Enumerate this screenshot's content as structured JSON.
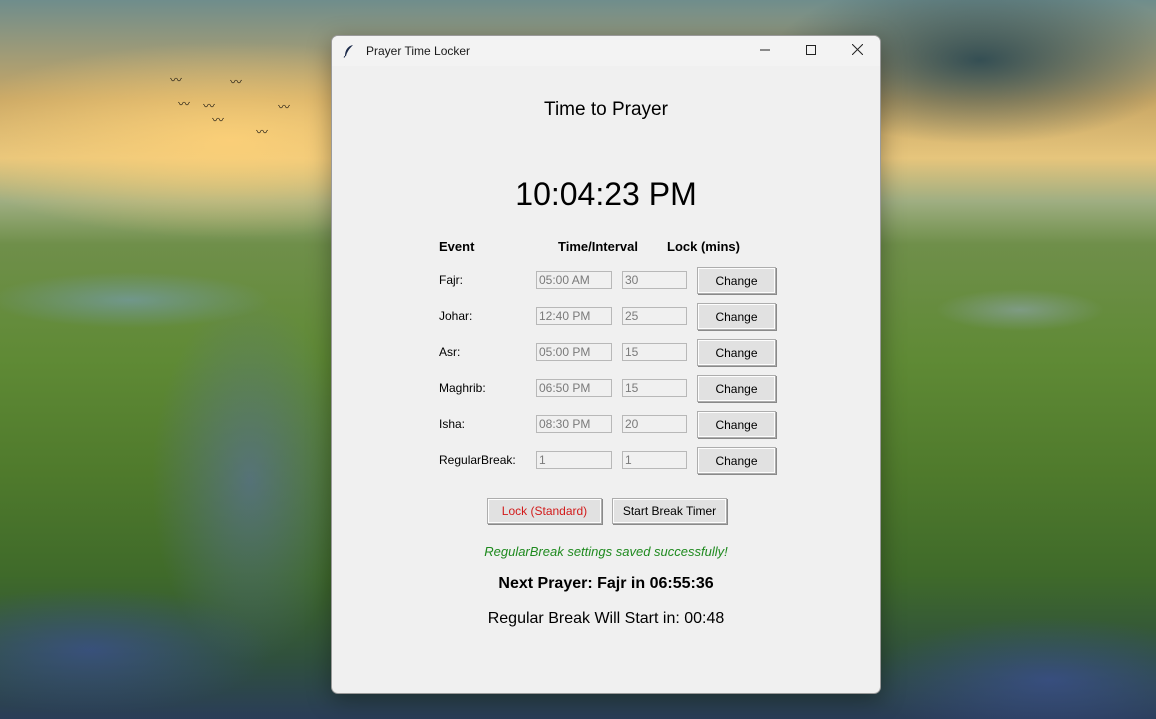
{
  "window": {
    "title": "Prayer Time Locker",
    "controls": {
      "minimize_icon": "minimize-icon",
      "maximize_icon": "maximize-icon",
      "close_icon": "close-icon"
    }
  },
  "main": {
    "heading": "Time to Prayer",
    "clock": "10:04:23 PM",
    "columns": {
      "event": "Event",
      "time_interval": "Time/Interval",
      "lock_mins": "Lock (mins)"
    },
    "rows": [
      {
        "label": "Fajr:",
        "time": "05:00 AM",
        "lock": "30",
        "button": "Change"
      },
      {
        "label": "Johar:",
        "time": "12:40 PM",
        "lock": "25",
        "button": "Change"
      },
      {
        "label": "Asr:",
        "time": "05:00 PM",
        "lock": "15",
        "button": "Change"
      },
      {
        "label": "Maghrib:",
        "time": "06:50 PM",
        "lock": "15",
        "button": "Change"
      },
      {
        "label": "Isha:",
        "time": "08:30 PM",
        "lock": "20",
        "button": "Change"
      },
      {
        "label": "RegularBreak:",
        "time": "1",
        "lock": "1",
        "button": "Change"
      }
    ],
    "actions": {
      "lock_label": "Lock (Standard)",
      "break_label": "Start Break Timer"
    },
    "status_message": "RegularBreak settings saved successfully!",
    "next_prayer": "Next Prayer: Fajr in 06:55:36",
    "break_start": "Regular Break Will Start in: 00:48"
  },
  "colors": {
    "lock_button_text": "#d21a1a",
    "status_success": "#1f8a1f",
    "window_bg": "#f0f0f0"
  }
}
